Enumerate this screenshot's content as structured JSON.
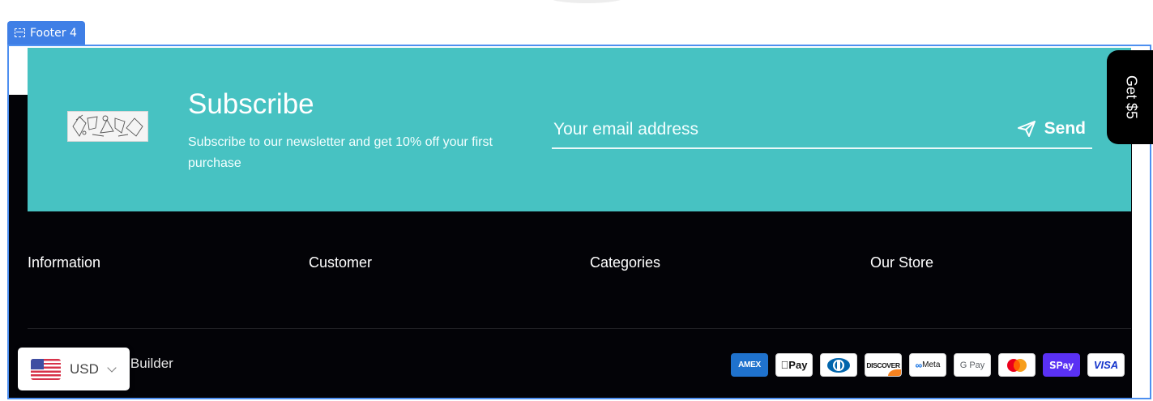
{
  "section_tag": {
    "label": "Footer 4"
  },
  "subscribe": {
    "title": "Subscribe",
    "description": "Subscribe to our newsletter and get 10% off your first purchase",
    "email_placeholder": "Your email address",
    "send_label": "Send",
    "background": "#47c2c2"
  },
  "promo_tab": {
    "label": "Get $5"
  },
  "columns": [
    {
      "title": "Information"
    },
    {
      "title": "Customer"
    },
    {
      "title": "Categories"
    },
    {
      "title": "Our Store"
    }
  ],
  "copyright": "ed © 2022 Veda Builder",
  "payments": [
    {
      "label": "AMEX",
      "icon": "amex-icon"
    },
    {
      "label": "Pay",
      "icon": "apple-pay-icon"
    },
    {
      "label": "Diners",
      "icon": "diners-club-icon"
    },
    {
      "label": "DISCOVER",
      "icon": "discover-icon"
    },
    {
      "label": "Meta",
      "icon": "meta-pay-icon"
    },
    {
      "label": "G Pay",
      "icon": "google-pay-icon"
    },
    {
      "label": "Mastercard",
      "icon": "mastercard-icon"
    },
    {
      "label": "Pay",
      "icon": "shop-pay-icon"
    },
    {
      "label": "VISA",
      "icon": "visa-icon"
    }
  ],
  "currency": {
    "code": "USD",
    "flag": "us-flag-icon"
  },
  "colors": {
    "accent": "#4d8ff0",
    "footer_bg": "#030307",
    "subscribe_bg": "#47c2c2"
  }
}
